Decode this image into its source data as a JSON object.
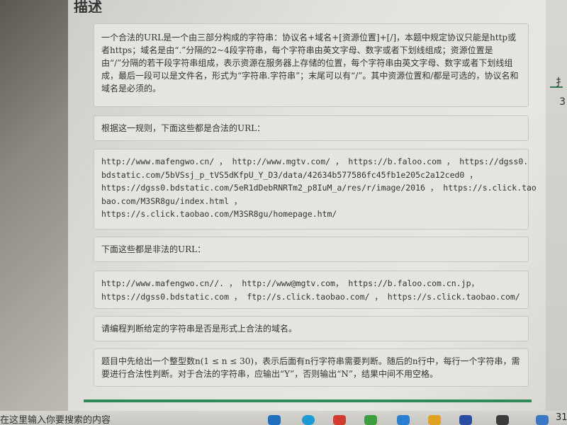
{
  "section_heading": "描述",
  "paragraphs": {
    "p1": "一个合法的URL是一个由三部分构成的字符串：协议名+域名+[资源位置]+[/]，本题中规定协议只能是http或者https；域名是由“.”分隔的2~4段字符串，每个字符串由英文字母、数字或者下划线组成；资源位置是由“/”分隔的若干段字符串组成，表示资源在服务器上存储的位置，每个字符串由英文字母、数字或者下划线组成，最后一段可以是文件名，形式为“字符串.字符串”；末尾可以有“/”。其中资源位置和/都是可选的，协议名和域名是必须的。",
    "p2": "根据这一规则，下面这些都是合法的URL：",
    "legal_lines": [
      "http://www.mafengwo.cn/ ， http://www.mgtv.com/ ，  https://b.faloo.com ， https://dgss0.",
      "bdstatic.com/5bVSsj_p_tVS5dKfpU_Y_D3/data/42634b577586fc45fb1e205c2a12ced0 ，",
      "https://dgss0.bdstatic.com/5eR1dDebRNRTm2_p8IuM_a/res/r/image/2016 ， https://s.click.tao",
      "bao.com/M3SR8gu/index.html ，",
      "https://s.click.taobao.com/M3SR8gu/homepage.htm/"
    ],
    "p3": "下面这些都是非法的URL：",
    "illegal_lines": [
      "http://www.mafengwo.cn//. ，   http://www@mgtv.com，   https://b.faloo.com.cn.jp，",
      "https://dgss0.bdstatic.com ，  ftp://s.click.taobao.com/ ，  https://s.click.taobao.com/"
    ],
    "p4": "请编程判断给定的字符串是否是形式上合法的域名。",
    "p5": "题目中先给出一个整型数n(1 ≤ n ≤ 30)，表示后面有n行字符串需要判断。随后的n行中，每行一个字符串，需要进行合法性判断。对于合法的字符串，应输出“Y”，否则输出“N”，结果中间不用空格。"
  },
  "right_edge_glyphs": [
    "扌",
    "3"
  ],
  "taskbar": {
    "search_text": "在这里输入你要搜索的内容",
    "clock_fragment": "31"
  },
  "colors": {
    "accent_green": "#2f8a58",
    "box_bg": "#e6e4de"
  }
}
